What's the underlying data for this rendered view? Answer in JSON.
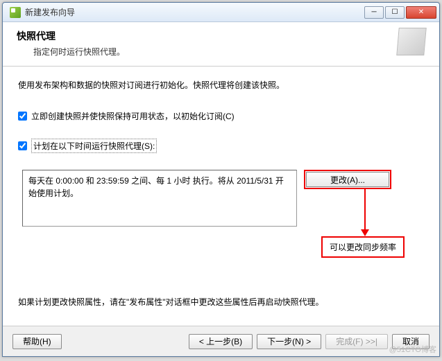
{
  "window": {
    "title": "新建发布向导"
  },
  "header": {
    "title": "快照代理",
    "subtitle": "指定何时运行快照代理。"
  },
  "content": {
    "intro": "使用发布架构和数据的快照对订阅进行初始化。快照代理将创建该快照。",
    "check1": "立即创建快照并使快照保持可用状态，以初始化订阅(C)",
    "check2": "计划在以下时间运行快照代理(S):",
    "schedule_text": "每天在 0:00:00 和 23:59:59 之间、每 1 小时 执行。将从 2011/5/31 开始使用计划。",
    "change_btn": "更改(A)...",
    "note": "可以更改同步频率",
    "bottom": "如果计划更改快照属性，请在\"发布属性\"对话框中更改这些属性后再启动快照代理。"
  },
  "footer": {
    "help": "帮助(H)",
    "back": "< 上一步(B)",
    "next": "下一步(N) >",
    "finish": "完成(F) >>|",
    "cancel": "取消"
  },
  "watermark": "@51CTO博客"
}
